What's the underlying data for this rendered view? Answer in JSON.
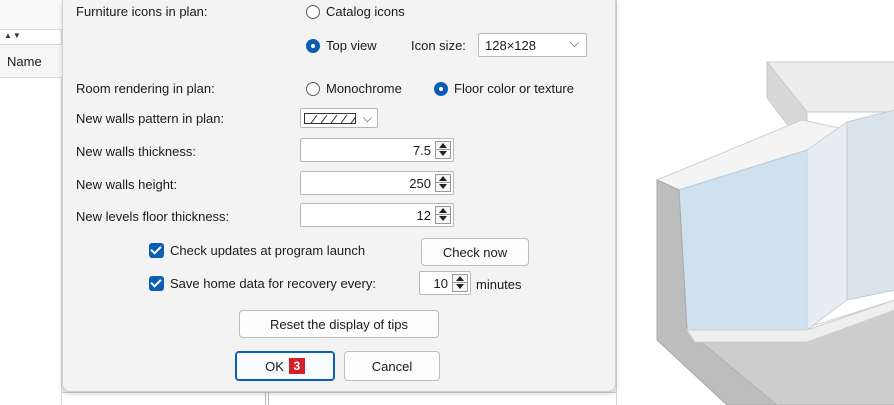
{
  "left_panel": {
    "column_header": "Name"
  },
  "dialog": {
    "furniture_icons": {
      "label": "Furniture icons in plan:",
      "option_catalog": "Catalog icons",
      "option_top_view": "Top view",
      "selected": "Top view",
      "icon_size_label": "Icon size:",
      "icon_size_value": "128×128"
    },
    "room_rendering": {
      "label": "Room rendering in plan:",
      "option_monochrome": "Monochrome",
      "option_floor": "Floor color or texture",
      "selected": "Floor color or texture"
    },
    "walls_pattern": {
      "label": "New walls pattern in plan:"
    },
    "walls_thickness": {
      "label": "New walls thickness:",
      "value": "7.5"
    },
    "walls_height": {
      "label": "New walls height:",
      "value": "250"
    },
    "levels_floor_thickness": {
      "label": "New levels floor thickness:",
      "value": "12"
    },
    "check_updates": {
      "label": "Check updates at program launch",
      "checked": true,
      "button": "Check now"
    },
    "save_recovery": {
      "label": "Save home data for recovery every:",
      "checked": true,
      "value": "10",
      "unit": "minutes"
    },
    "reset_tips_button": "Reset the display of tips",
    "ok_button": "OK",
    "ok_badge": "3",
    "cancel_button": "Cancel"
  },
  "colors": {
    "accent": "#0a5fb4",
    "badge": "#d42027"
  }
}
